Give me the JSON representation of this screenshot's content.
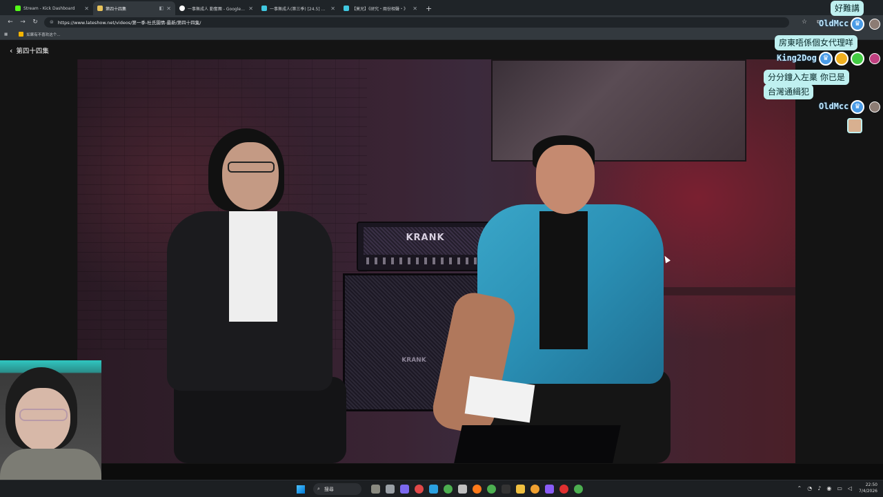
{
  "browser": {
    "tabs": [
      {
        "title": "Stream - Kick Dashboard",
        "favicon_color": "#53fc18",
        "active": false
      },
      {
        "title": "第四十四集",
        "favicon_color": "#e8c35a",
        "active": true
      },
      {
        "title": "一事無成人 勤奮團 - Google 搜尋",
        "favicon_color": "#ffffff",
        "active": false
      },
      {
        "title": "一事無成人(第三季) [24.5] 身上有",
        "favicon_color": "#40c8e0",
        "active": false
      },
      {
        "title": "【莫兄】《研究・兩份相聲・》",
        "favicon_color": "#40c8e0",
        "active": false
      }
    ],
    "new_tab": "+",
    "url": "https://www.lateshow.net/videos/第一季-杜氏園情-最新/第四十四集/",
    "bookmark": "如果有不喜欢这个..."
  },
  "page": {
    "back_label": "第四十四集",
    "amp_brand": "KRANK",
    "cab_brand": "KRANK"
  },
  "chat": {
    "messages": [
      {
        "text": "好難講"
      },
      {
        "user": "OldMcc"
      },
      {
        "text": "房東唔係個女代理咩"
      },
      {
        "user": "King2Dog"
      },
      {
        "text": "分分鐘入左稟  你已是"
      },
      {
        "text": "台灣通緝犯"
      },
      {
        "user": "OldMcc"
      }
    ]
  },
  "taskbar": {
    "search_label": "搜尋",
    "time": "22:50",
    "date": "7/4/2026"
  }
}
